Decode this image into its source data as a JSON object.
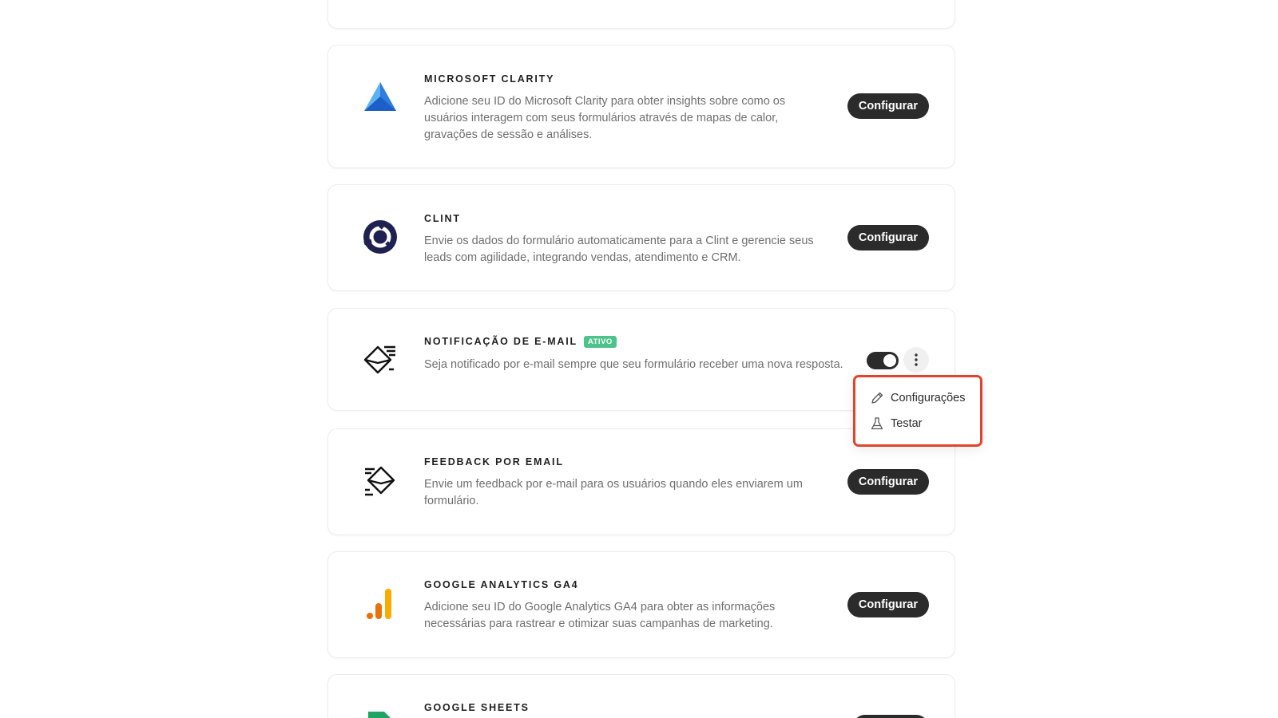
{
  "integrations": [
    {
      "title": "MICROSOFT CLARITY",
      "description": "Adicione seu ID do Microsoft Clarity para obter insights sobre como os usuários interagem com seus formulários através de mapas de calor, gravações de sessão e análises.",
      "button": "Configurar",
      "icon": "microsoft-clarity-logo"
    },
    {
      "title": "CLINT",
      "description": "Envie os dados do formulário automaticamente para a Clint e gerencie seus leads com agilidade, integrando vendas, atendimento e CRM.",
      "button": "Configurar",
      "icon": "clint-logo"
    },
    {
      "title": "NOTIFICAÇÃO DE E-MAIL",
      "badge": "ATIVO",
      "description": "Seja notificado por e-mail sempre que seu formulário receber uma nova resposta.",
      "toggle_on": true,
      "icon": "email-notification-icon"
    },
    {
      "title": "FEEDBACK POR EMAIL",
      "description": "Envie um feedback por e-mail para os usuários quando eles enviarem um formulário.",
      "button": "Configurar",
      "icon": "email-feedback-icon"
    },
    {
      "title": "GOOGLE ANALYTICS GA4",
      "description": "Adicione seu ID do Google Analytics GA4 para obter as informações necessárias para rastrear e otimizar suas campanhas de marketing.",
      "button": "Configurar",
      "icon": "google-analytics-logo"
    },
    {
      "title": "GOOGLE SHEETS",
      "icon": "google-sheets-logo"
    }
  ],
  "dropdown": {
    "items": [
      {
        "label": "Configurações",
        "icon": "pencil-icon"
      },
      {
        "label": "Testar",
        "icon": "flask-icon"
      }
    ]
  },
  "colors": {
    "button_bg": "#2b2b2b",
    "badge_bg": "#4cc38a",
    "highlight": "#e0442c",
    "clarity_blue": "#2f7de1",
    "clint_navy": "#1f2251",
    "ga_orange": "#f29d0a",
    "sheets_green": "#1fa463"
  }
}
